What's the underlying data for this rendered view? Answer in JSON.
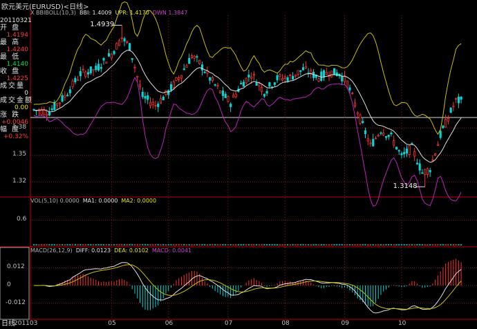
{
  "title": "欧元美元(EURUSD)<日线>",
  "info": {
    "date": "20110321",
    "rows": [
      {
        "label": "开 盘",
        "value": "1.4194",
        "color": "#ff3b3b"
      },
      {
        "label": "最 高",
        "value": "1.4240",
        "color": "#ff3b3b"
      },
      {
        "label": "最 低",
        "value": "1.4140",
        "color": "#00e050"
      },
      {
        "label": "收 盘",
        "value": "1.4225",
        "color": "#ff3b3b"
      },
      {
        "label": "成交量",
        "value": "0",
        "color": "#e0e0e0"
      },
      {
        "label": "成交金额",
        "value": "0.00",
        "color": "#e8e800"
      },
      {
        "label": "涨 跌",
        "value": "+0.0046",
        "color": "#ff3b3b"
      },
      {
        "label": "幅 度",
        "value": "+0.32%",
        "color": "#ff3b3b"
      }
    ]
  },
  "legends": {
    "boll": [
      {
        "text": "X BBIBOLL(10,3)",
        "color": "#b0b0b0"
      },
      {
        "text": "BBI: 1.4009",
        "color": "#e0e0e0"
      },
      {
        "text": "UPR: 1.4170",
        "color": "#e8e800"
      },
      {
        "text": "DWN 1.3847",
        "color": "#d040d0"
      }
    ],
    "vol": [
      {
        "text": "VOL(5,10) 0.0000",
        "color": "#b0b0b0"
      },
      {
        "text": "MA1: 0.0000",
        "color": "#e0e0e0"
      },
      {
        "text": "MA2: 0.0000",
        "color": "#e8e800"
      }
    ],
    "macd": [
      {
        "text": "MACD(26,12,9)",
        "color": "#b0b0b0"
      },
      {
        "text": "DIFF: 0.0123",
        "color": "#e0e0e0"
      },
      {
        "text": "DEA: 0.0102",
        "color": "#e8e800"
      },
      {
        "text": "MACD: 0.0041",
        "color": "#d040d0"
      }
    ]
  },
  "x_axis": {
    "start_label": "201103",
    "month_labels": [
      "05",
      "06",
      "07",
      "08",
      "09",
      "10"
    ],
    "bottom_left_label": "日线"
  },
  "colors": {
    "up": "#ff3030",
    "down": "#00d8d8",
    "grid": "#8a1c1c",
    "axis": "#c00000",
    "mid": "#e0e0e0",
    "upper": "#c8c000",
    "lower": "#c020c0"
  },
  "chart_data": [
    {
      "type": "candlestick",
      "panel": "price",
      "series_label": "BBIBOLL(10,3)",
      "y_ticks": [
        1.32,
        1.35,
        1.38
      ],
      "ylim": [
        1.305,
        1.505
      ],
      "month_boundaries": [
        {
          "label": "05",
          "index": 30
        },
        {
          "label": "06",
          "index": 52
        },
        {
          "label": "07",
          "index": 75
        },
        {
          "label": "08",
          "index": 97
        },
        {
          "label": "09",
          "index": 120
        },
        {
          "label": "10",
          "index": 142
        }
      ],
      "annotations": [
        {
          "text": "1.4939",
          "index": 34,
          "value": 1.4939
        },
        {
          "text": "1.3148",
          "index": 151,
          "value": 1.3148
        }
      ],
      "close_anchors": [
        [
          0,
          1.4
        ],
        [
          6,
          1.398
        ],
        [
          12,
          1.415
        ],
        [
          18,
          1.44
        ],
        [
          24,
          1.445
        ],
        [
          30,
          1.462
        ],
        [
          34,
          1.48
        ],
        [
          37,
          1.47
        ],
        [
          42,
          1.415
        ],
        [
          47,
          1.405
        ],
        [
          52,
          1.42
        ],
        [
          57,
          1.44
        ],
        [
          61,
          1.46
        ],
        [
          64,
          1.452
        ],
        [
          68,
          1.435
        ],
        [
          72,
          1.42
        ],
        [
          76,
          1.408
        ],
        [
          80,
          1.428
        ],
        [
          84,
          1.44
        ],
        [
          89,
          1.42
        ],
        [
          94,
          1.435
        ],
        [
          99,
          1.436
        ],
        [
          104,
          1.445
        ],
        [
          110,
          1.436
        ],
        [
          114,
          1.442
        ],
        [
          118,
          1.44
        ],
        [
          121,
          1.43
        ],
        [
          126,
          1.39
        ],
        [
          130,
          1.36
        ],
        [
          134,
          1.378
        ],
        [
          138,
          1.37
        ],
        [
          142,
          1.348
        ],
        [
          146,
          1.358
        ],
        [
          150,
          1.33
        ],
        [
          153,
          1.335
        ],
        [
          157,
          1.372
        ],
        [
          161,
          1.398
        ],
        [
          163,
          1.41
        ]
      ]
    },
    {
      "type": "bar",
      "panel": "volume",
      "series_label": "VOL(5,10)",
      "y_ticks": [
        0.6
      ],
      "ylim": [
        0,
        1.0
      ],
      "values_note_zero": true
    },
    {
      "type": "bar-line",
      "panel": "macd",
      "series_label": "MACD(26,12,9)",
      "y_ticks": [
        0.012,
        0,
        -0.012
      ],
      "ylim": [
        -0.022,
        0.022
      ]
    }
  ]
}
